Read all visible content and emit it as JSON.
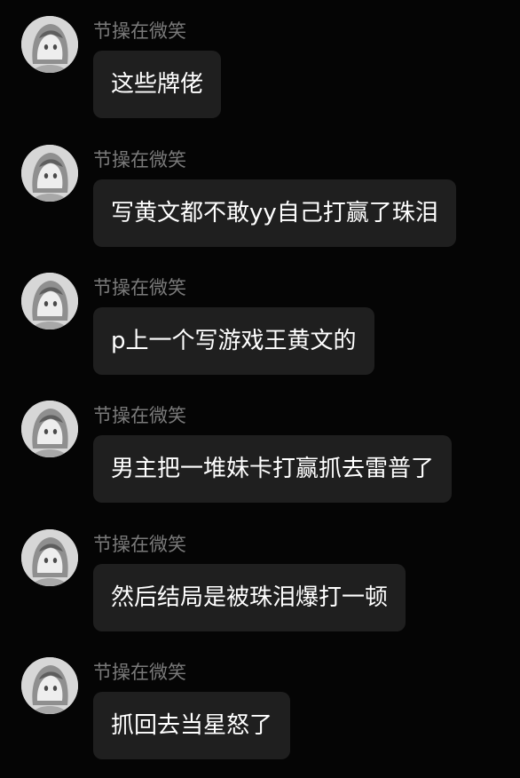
{
  "messages": [
    {
      "sender": "节操在微笑",
      "text": "这些牌佬"
    },
    {
      "sender": "节操在微笑",
      "text": "写黄文都不敢yy自己打赢了珠泪"
    },
    {
      "sender": "节操在微笑",
      "text": "p上一个写游戏王黄文的"
    },
    {
      "sender": "节操在微笑",
      "text": "男主把一堆妹卡打赢抓去雷普了"
    },
    {
      "sender": "节操在微笑",
      "text": "然后结局是被珠泪爆打一顿"
    },
    {
      "sender": "节操在微笑",
      "text": "抓回去当星怒了"
    }
  ],
  "colors": {
    "background": "#050505",
    "bubble": "#1f1f1f",
    "sender_text": "#7a7a7a",
    "message_text": "#ffffff"
  },
  "icons": {
    "avatar": "anime-character-avatar-icon"
  }
}
